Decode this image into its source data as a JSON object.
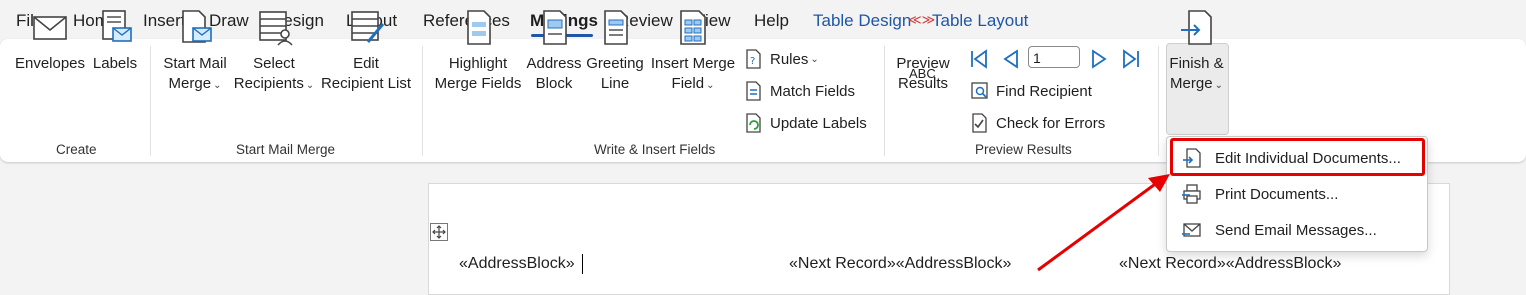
{
  "tabs": [
    "File",
    "Home",
    "Insert",
    "Draw",
    "Design",
    "Layout",
    "References",
    "Mailings",
    "Review",
    "View",
    "Help",
    "Table Design",
    "Table Layout"
  ],
  "ribbon": {
    "create": {
      "envelopes": "Envelopes",
      "labels": "Labels",
      "group": "Create"
    },
    "start_mail_merge": {
      "start_line1": "Start Mail",
      "start_line2": "Merge",
      "select_line1": "Select",
      "select_line2": "Recipients",
      "edit_line1": "Edit",
      "edit_line2": "Recipient List",
      "group": "Start Mail Merge"
    },
    "write_insert": {
      "highlight_line1": "Highlight",
      "highlight_line2": "Merge Fields",
      "address_line1": "Address",
      "address_line2": "Block",
      "greeting_line1": "Greeting",
      "greeting_line2": "Line",
      "insert_line1": "Insert Merge",
      "insert_line2": "Field",
      "rules": "Rules",
      "match_fields": "Match Fields",
      "update_labels": "Update Labels",
      "group": "Write & Insert Fields"
    },
    "preview": {
      "abc": "ABC",
      "preview_line1": "Preview",
      "preview_line2": "Results",
      "record": "1",
      "find_recipient": "Find Recipient",
      "check_errors": "Check for Errors",
      "group": "Preview Results"
    },
    "finish": {
      "line1": "Finish &",
      "line2": "Merge"
    }
  },
  "menu": {
    "edit": "Edit Individual Documents...",
    "print": "Print Documents...",
    "email": "Send Email Messages..."
  },
  "document": {
    "field1": "«AddressBlock»",
    "field2": "«Next Record»«AddressBlock»",
    "field3": "«Next Record»«AddressBlock»"
  },
  "colors": {
    "accent": "#1f56a8",
    "highlight": "#e60000"
  }
}
